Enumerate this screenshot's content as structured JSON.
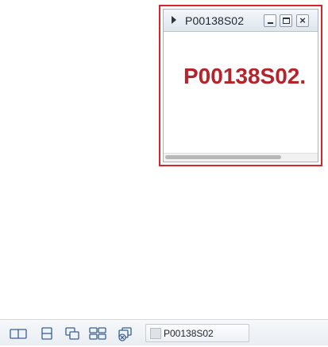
{
  "window": {
    "title": "P00138S02",
    "content_label": "P00138S02.",
    "controls": {
      "minimize": "minimize",
      "maximize": "maximize",
      "close": "×"
    }
  },
  "taskbar": {
    "icons": [
      "tile-vertical-icon",
      "tile-horizontal-icon",
      "cascade-icon",
      "grid-icon",
      "close-all-icon"
    ],
    "items": [
      {
        "label": "P00138S02"
      }
    ]
  },
  "colors": {
    "highlight_border": "#d6262b",
    "content_text": "#b5242b"
  }
}
